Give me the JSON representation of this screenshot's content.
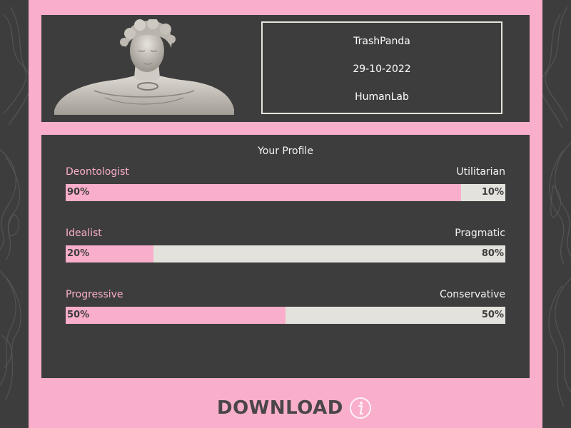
{
  "header": {
    "username": "TrashPanda",
    "date": "29-10-2022",
    "organization": "HumanLab"
  },
  "profile": {
    "title": "Your Profile",
    "traits": [
      {
        "left_label": "Deontologist",
        "right_label": "Utilitarian",
        "left_pct": "90%",
        "right_pct": "10%",
        "left_value": 90
      },
      {
        "left_label": "Idealist",
        "right_label": "Pragmatic",
        "left_pct": "20%",
        "right_pct": "80%",
        "left_value": 20
      },
      {
        "left_label": "Progressive",
        "right_label": "Conservative",
        "left_pct": "50%",
        "right_pct": "50%",
        "left_value": 50
      }
    ]
  },
  "download": {
    "label": "DOWNLOAD",
    "icon": "info-icon"
  },
  "colors": {
    "accent_pink": "#f9aecb",
    "dark_panel": "#3d3d3d",
    "bar_track": "#e4e2dc",
    "text_light": "#f2f2f2"
  }
}
